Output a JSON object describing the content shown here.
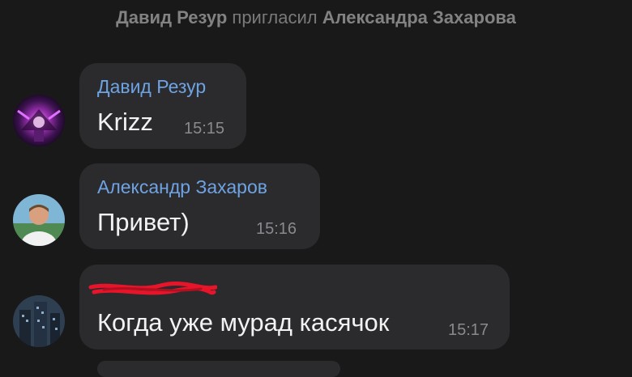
{
  "service_message": {
    "actor": "Давид Резур",
    "action": "пригласил",
    "target": "Александра Захарова"
  },
  "messages": [
    {
      "sender": "Давид Резур",
      "text": "Krizz",
      "time": "15:15",
      "avatar": "purple-abstract-avatar"
    },
    {
      "sender": "Александр Захаров",
      "text": "Привет)",
      "time": "15:16",
      "avatar": "person-photo-avatar"
    },
    {
      "sender": "",
      "sender_redacted": true,
      "text": "Когда уже мурад касячок",
      "time": "15:17",
      "avatar": "city-night-avatar"
    }
  ],
  "colors": {
    "background": "#191919",
    "bubble": "#2b2b2e",
    "sender_name": "#6ea3e3",
    "redaction": "#e8142a"
  }
}
